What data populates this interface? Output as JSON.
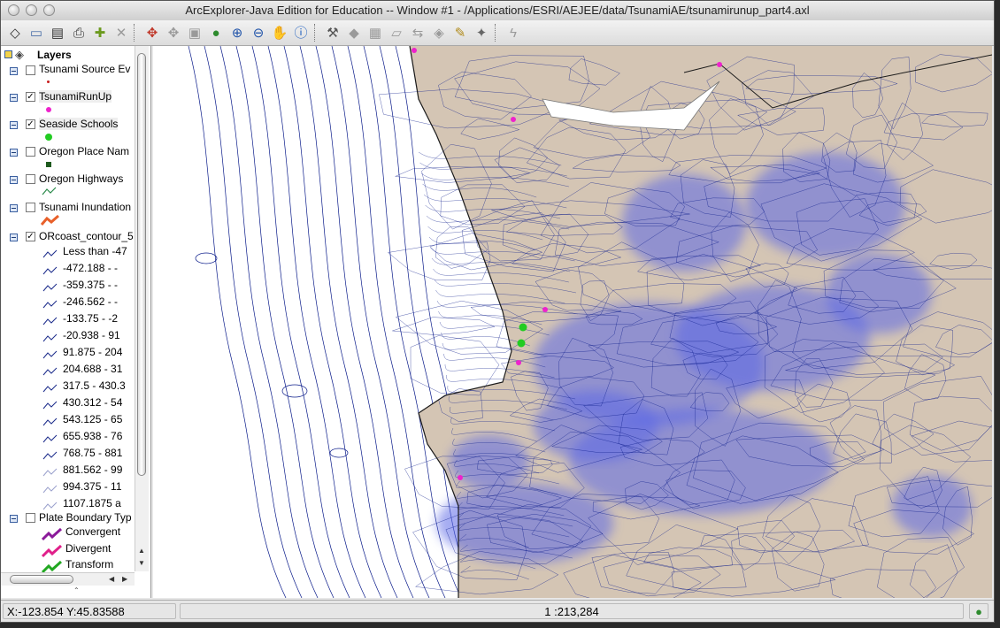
{
  "window": {
    "title": "ArcExplorer-Java Edition for Education -- Window #1 - /Applications/ESRI/AEJEE/data/TsunamiAE/tsunamirunup_part4.axl"
  },
  "toolbar": {
    "buttons": [
      {
        "name": "new-icon",
        "glyph": "◇"
      },
      {
        "name": "open-icon",
        "glyph": "▭"
      },
      {
        "name": "save-icon",
        "glyph": "▤"
      },
      {
        "name": "print-icon",
        "glyph": "⎙"
      },
      {
        "name": "add-layer-icon",
        "glyph": "✚"
      },
      {
        "name": "remove-layer-icon",
        "glyph": "✕"
      },
      {
        "name": "zoom-full-extent-icon",
        "glyph": "✥"
      },
      {
        "name": "zoom-previous-icon",
        "glyph": "✥"
      },
      {
        "name": "zoom-layer-icon",
        "glyph": "▣"
      },
      {
        "name": "globe-icon",
        "glyph": "●"
      },
      {
        "name": "zoom-in-icon",
        "glyph": "⊕"
      },
      {
        "name": "zoom-out-icon",
        "glyph": "⊖"
      },
      {
        "name": "pan-hand-icon",
        "glyph": "✋"
      },
      {
        "name": "identify-icon",
        "glyph": "ⓘ"
      },
      {
        "name": "find-icon",
        "glyph": "⚒"
      },
      {
        "name": "query-icon",
        "glyph": "◆"
      },
      {
        "name": "select-icon",
        "glyph": "▦"
      },
      {
        "name": "clear-selection-icon",
        "glyph": "▱"
      },
      {
        "name": "measure-icon",
        "glyph": "⇆"
      },
      {
        "name": "buffer-icon",
        "glyph": "◈"
      },
      {
        "name": "hotlink-icon",
        "glyph": "✎"
      },
      {
        "name": "map-tips-icon",
        "glyph": "✦"
      },
      {
        "name": "lightning-icon",
        "glyph": "ϟ"
      }
    ]
  },
  "layers_panel": {
    "header": "Layers",
    "layers": [
      {
        "label": "Tsunami Source Ev",
        "checked": false,
        "symbol": "red-dot-icon"
      },
      {
        "label": "TsunamiRunUp",
        "checked": true,
        "symbol": "magenta-dot-icon"
      },
      {
        "label": "Seaside Schools",
        "checked": true,
        "symbol": "green-dot-icon"
      },
      {
        "label": "Oregon Place Nam",
        "checked": false,
        "symbol": "dark-green-square-icon"
      },
      {
        "label": "Oregon Highways",
        "checked": false,
        "symbol": "green-line-icon"
      },
      {
        "label": "Tsunami Inundation",
        "checked": false,
        "symbol": "orange-line-icon"
      },
      {
        "label": "ORcoast_contour_5",
        "checked": true,
        "symbol": ""
      }
    ],
    "contour_classes": [
      "Less than -47",
      "-472.188 - -",
      "-359.375 - -",
      "-246.562 - -",
      "-133.75 - -2",
      "-20.938 - 91",
      "91.875 - 204",
      "204.688 - 31",
      "317.5 - 430.3",
      "430.312 - 54",
      "543.125 - 65",
      "655.938 - 76",
      "768.75 - 881",
      "881.562 - 99",
      "994.375 - 11",
      "1107.1875 a"
    ],
    "plate_layer": {
      "label": "Plate Boundary Typ",
      "checked": false
    },
    "plate_classes": [
      "Convergent",
      "Divergent",
      "Transform"
    ]
  },
  "colors": {
    "land": "#d4c5b4",
    "contour_dark": "#0a1b8a",
    "contour_fill": "#5c68e6",
    "convergent": "#8b1a9a",
    "divergent": "#e0208a",
    "transform": "#22a822",
    "runup": "#ee22cc",
    "schools": "#22cc22"
  },
  "status": {
    "coords": "X:-123.854 Y:45.83588",
    "scale": "1 :213,284"
  }
}
